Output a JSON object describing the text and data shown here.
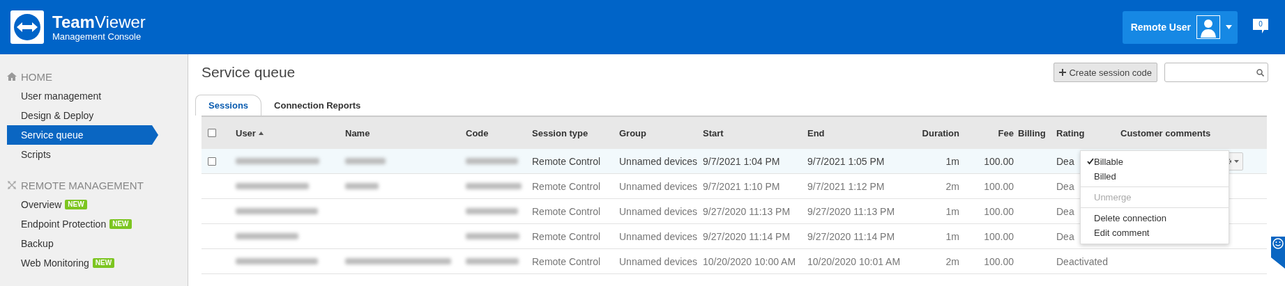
{
  "header": {
    "brand": "**Team**Viewer",
    "subtitle": "Management Console",
    "user_button": "Remote User",
    "notifications": "0"
  },
  "sidebar": {
    "sections": [
      {
        "kind": "home",
        "title": "HOME",
        "items": [
          {
            "label": "User management",
            "selected": false
          },
          {
            "label": "Design & Deploy",
            "selected": false
          },
          {
            "label": "Service queue",
            "selected": true
          },
          {
            "label": "Scripts",
            "selected": false
          }
        ]
      },
      {
        "kind": "remote",
        "title": "REMOTE MANAGEMENT",
        "items": [
          {
            "label": "Overview",
            "badge": "NEW",
            "selected": false
          },
          {
            "label": "Endpoint Protection",
            "badge": "NEW",
            "selected": false
          },
          {
            "label": "Backup",
            "selected": false
          },
          {
            "label": "Web Monitoring",
            "badge": "NEW",
            "selected": false
          }
        ]
      }
    ]
  },
  "page": {
    "title": "Service queue",
    "create_button": "Create session code"
  },
  "tabs": [
    {
      "label": "Sessions",
      "selected": true
    },
    {
      "label": "Connection Reports",
      "selected": false
    }
  ],
  "table": {
    "select_all_checked": false,
    "columns": [
      {
        "label": "User",
        "sorted_ascending": true,
        "right_aligned": false
      },
      {
        "label": "Name",
        "sorted_ascending": false,
        "right_aligned": false
      },
      {
        "label": "Code",
        "sorted_ascending": false,
        "right_aligned": false
      },
      {
        "label": "Session type",
        "sorted_ascending": false,
        "right_aligned": false
      },
      {
        "label": "Group",
        "sorted_ascending": false,
        "right_aligned": false
      },
      {
        "label": "Start",
        "sorted_ascending": false,
        "right_aligned": false
      },
      {
        "label": "End",
        "sorted_ascending": false,
        "right_aligned": false
      },
      {
        "label": "Duration",
        "sorted_ascending": false,
        "right_aligned": true
      },
      {
        "label": "Fee",
        "sorted_ascending": false,
        "right_aligned": true
      },
      {
        "label": "Billing",
        "sorted_ascending": false,
        "right_aligned": false
      },
      {
        "label": "Rating",
        "sorted_ascending": false,
        "right_aligned": false
      },
      {
        "label": "Customer comments",
        "sorted_ascending": false,
        "right_aligned": false
      }
    ],
    "rows": [
      {
        "highlighted": true,
        "checked": false,
        "user_blurred": true,
        "name_blurred": true,
        "code_blurred": true,
        "session_type": "Remote Control",
        "group": "Unnamed devices",
        "start": "9/7/2021 1:04 PM",
        "end": "9/7/2021 1:05 PM",
        "duration": "1m",
        "fee": "100.00",
        "rating": "Dea"
      },
      {
        "highlighted": false,
        "user_blurred": true,
        "name_blurred": true,
        "code_blurred": true,
        "session_type": "Remote Control",
        "group": "Unnamed devices",
        "start": "9/7/2021 1:10 PM",
        "end": "9/7/2021 1:12 PM",
        "duration": "2m",
        "fee": "100.00",
        "rating": "Dea"
      },
      {
        "highlighted": false,
        "user_blurred": true,
        "name_blurred": false,
        "code_blurred": true,
        "session_type": "Remote Control",
        "group": "Unnamed devices",
        "start": "9/27/2020 11:13 PM",
        "end": "9/27/2020 11:13 PM",
        "duration": "1m",
        "fee": "100.00",
        "rating": "Dea"
      },
      {
        "highlighted": false,
        "user_blurred": true,
        "name_blurred": false,
        "code_blurred": true,
        "session_type": "Remote Control",
        "group": "Unnamed devices",
        "start": "9/27/2020 11:14 PM",
        "end": "9/27/2020 11:14 PM",
        "duration": "1m",
        "fee": "100.00",
        "rating": "Dea"
      },
      {
        "highlighted": false,
        "user_blurred": true,
        "name_blurred": true,
        "code_blurred": true,
        "session_type": "Remote Control",
        "group": "Unnamed devices",
        "start": "10/20/2020 10:00 AM",
        "end": "10/20/2020 10:01 AM",
        "duration": "2m",
        "fee": "100.00",
        "rating": "Deactivated"
      }
    ]
  },
  "context_menu": {
    "items": [
      {
        "kind": "item",
        "label": "Billable",
        "checked": true,
        "disabled": false
      },
      {
        "kind": "item",
        "label": "Billed",
        "checked": false,
        "disabled": false
      },
      {
        "kind": "separator"
      },
      {
        "kind": "item",
        "label": "Unmerge",
        "checked": false,
        "disabled": true
      },
      {
        "kind": "separator"
      },
      {
        "kind": "item",
        "label": "Delete connection",
        "checked": false,
        "disabled": false
      },
      {
        "kind": "item",
        "label": "Edit comment",
        "checked": false,
        "disabled": false
      }
    ]
  }
}
